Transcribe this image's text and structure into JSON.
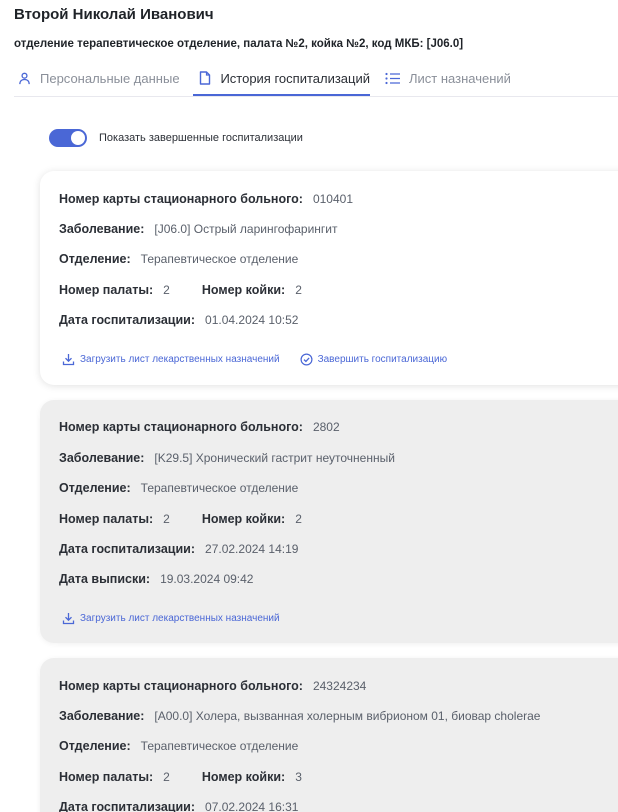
{
  "header": {
    "patient_name": "Второй Николай Иванович",
    "subtitle": "отделение терапевтическое отделение, палата №2, койка №2, код МКБ: [J06.0]"
  },
  "tabs": [
    {
      "label": "Персональные данные",
      "icon": "person-icon",
      "active": false
    },
    {
      "label": "История госпитализаций",
      "icon": "document-icon",
      "active": true
    },
    {
      "label": "Лист назначений",
      "icon": "list-icon",
      "active": false
    }
  ],
  "toggle": {
    "label": "Показать завершенные госпитализации",
    "on": true
  },
  "labels": {
    "card_number": "Номер карты стационарного больного:",
    "disease": "Заболевание:",
    "department": "Отделение:",
    "ward": "Номер палаты:",
    "bed": "Номер койки:",
    "admission_date": "Дата госпитализации:",
    "discharge_date": "Дата выписки:",
    "download_action": "Загрузить лист лекарственных назначений",
    "finish_action": "Завершить госпитализацию"
  },
  "hospitalizations": [
    {
      "card_number": "010401",
      "disease": "[J06.0] Острый ларингофарингит",
      "department": "Терапевтическое отделение",
      "ward": "2",
      "bed": "2",
      "admission_date": "01.04.2024 10:52",
      "status": "active"
    },
    {
      "card_number": "2802",
      "disease": "[K29.5] Хронический гастрит неуточненный",
      "department": "Терапевтическое отделение",
      "ward": "2",
      "bed": "2",
      "admission_date": "27.02.2024 14:19",
      "discharge_date": "19.03.2024 09:42",
      "status": "completed"
    },
    {
      "card_number": "24324234",
      "disease": "[A00.0] Холера, вызванная холерным вибрионом 01, биовар cholerae",
      "department": "Терапевтическое отделение",
      "ward": "2",
      "bed": "3",
      "admission_date": "07.02.2024 16:31",
      "status": "completed"
    }
  ],
  "colors": {
    "accent": "#4a67d6",
    "active_card_bg": "#ffffff",
    "completed_card_bg": "#eeeeee"
  }
}
